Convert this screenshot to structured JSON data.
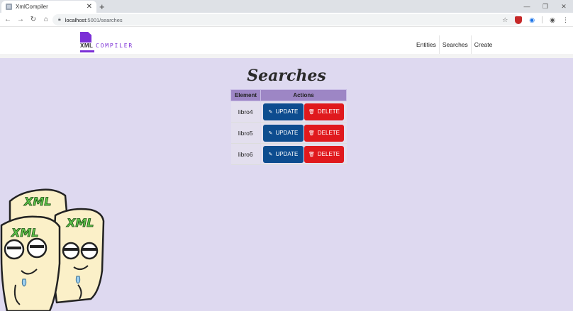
{
  "browser": {
    "tab_title": "XmlCompiler",
    "new_tab": "+",
    "url_host": "localhost",
    "url_rest": ":5001/searches"
  },
  "header": {
    "logo_xml": "XML",
    "logo_compiler": "COMPILER",
    "nav": [
      "Entities",
      "Searches",
      "Create"
    ]
  },
  "main": {
    "title": "Searches",
    "columns": [
      "Element",
      "Actions"
    ],
    "rows": [
      {
        "element": "libro4",
        "update": "UPDATE",
        "delete": "DELETE"
      },
      {
        "element": "libro5",
        "update": "UPDATE",
        "delete": "DELETE"
      },
      {
        "element": "libro6",
        "update": "UPDATE",
        "delete": "DELETE"
      }
    ]
  },
  "mascot": {
    "label": "XML"
  },
  "colors": {
    "update": "#0d4c8f",
    "delete": "#e0191d",
    "accent": "#7b2fd6",
    "background": "#ded9f0"
  }
}
